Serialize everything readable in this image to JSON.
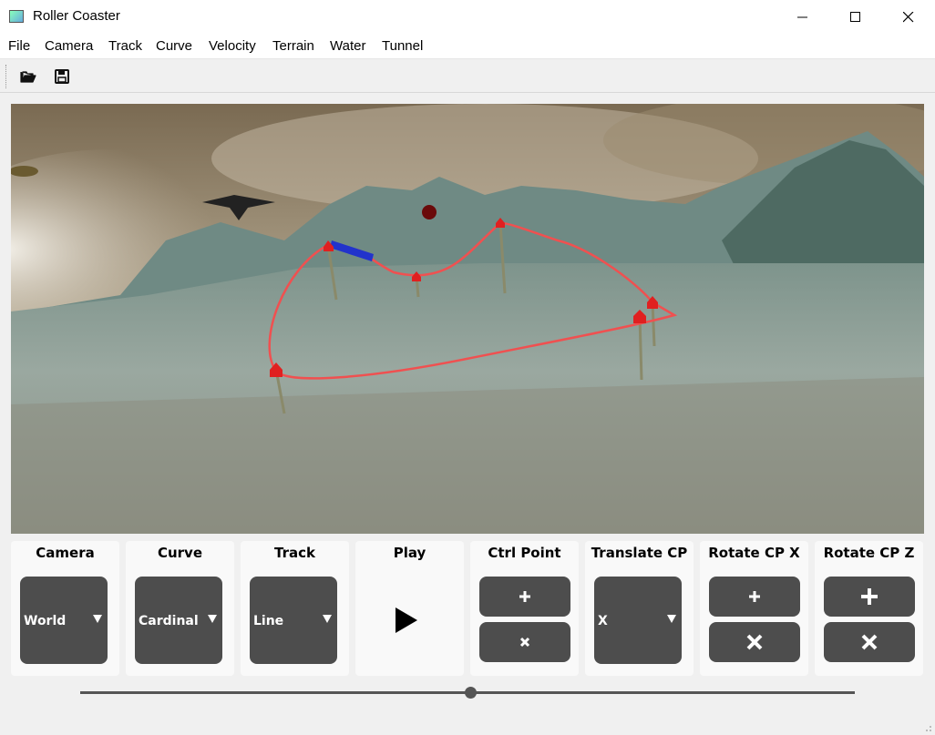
{
  "window": {
    "title": "Roller Coaster"
  },
  "menu": [
    "File",
    "Camera",
    "Track",
    "Curve",
    "Velocity",
    "Terrain",
    "Water",
    "Tunnel"
  ],
  "toolbar": {
    "open_icon": "folder-open-icon",
    "save_icon": "floppy-disk-icon"
  },
  "viewport": {
    "description_icon": "3d-scene"
  },
  "controls": {
    "camera": {
      "title": "Camera",
      "value": "World"
    },
    "curve": {
      "title": "Curve",
      "value": "Cardinal"
    },
    "track": {
      "title": "Track",
      "value": "Line"
    },
    "play": {
      "title": "Play",
      "icon": "play-icon"
    },
    "ctrl_point": {
      "title": "Ctrl Point",
      "add_icon": "plus-icon",
      "remove_icon": "x-icon"
    },
    "translate_cp": {
      "title": "Translate CP",
      "value": "X"
    },
    "rotate_cp_x": {
      "title": "Rotate CP X",
      "inc_icon": "plus-icon",
      "dec_icon": "x-icon"
    },
    "rotate_cp_z": {
      "title": "Rotate CP Z",
      "inc_icon": "plus-icon",
      "dec_icon": "x-icon"
    }
  },
  "slider": {
    "value_fraction": 0.5
  },
  "colors": {
    "track": "#f05050",
    "control_point": "#e02020",
    "train": "#2233cc",
    "button": "#4d4d4d"
  }
}
